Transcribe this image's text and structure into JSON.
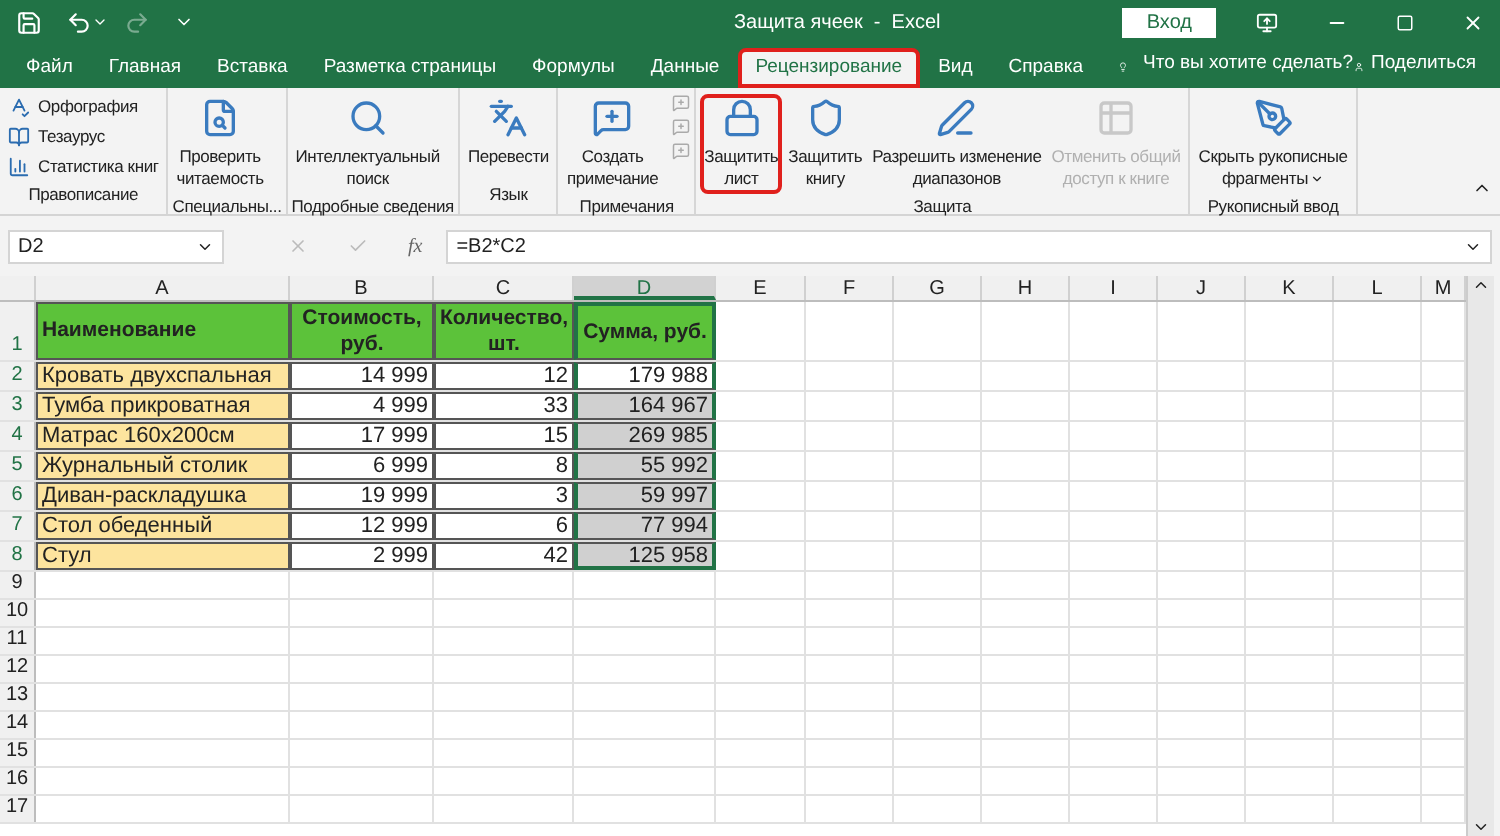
{
  "window": {
    "title": "Защита ячеек  -  Excel",
    "signin": "Вход"
  },
  "tabs": [
    {
      "label": "Файл",
      "selected": false,
      "highlighted": false
    },
    {
      "label": "Главная",
      "selected": false,
      "highlighted": false
    },
    {
      "label": "Вставка",
      "selected": false,
      "highlighted": false
    },
    {
      "label": "Разметка страницы",
      "selected": false,
      "highlighted": false
    },
    {
      "label": "Формулы",
      "selected": false,
      "highlighted": false
    },
    {
      "label": "Данные",
      "selected": false,
      "highlighted": false
    },
    {
      "label": "Рецензирование",
      "selected": true,
      "highlighted": true
    },
    {
      "label": "Вид",
      "selected": false,
      "highlighted": false
    },
    {
      "label": "Справка",
      "selected": false,
      "highlighted": false
    }
  ],
  "tell_me": "Что вы хотите сделать?",
  "share": "Поделиться",
  "ribbon": [
    {
      "label": "Правописание",
      "items": [
        {
          "kind": "small",
          "lines": [
            "Орфография"
          ],
          "disabled": false,
          "highlighted": false
        },
        {
          "kind": "small",
          "lines": [
            "Тезаурус"
          ],
          "disabled": false,
          "highlighted": false
        },
        {
          "kind": "small",
          "lines": [
            "Статистика книг"
          ],
          "disabled": false,
          "highlighted": false
        }
      ]
    },
    {
      "label": "Специальны...",
      "items": [
        {
          "kind": "large",
          "lines": [
            "Проверить",
            "читаемость"
          ],
          "disabled": false,
          "highlighted": false
        }
      ]
    },
    {
      "label": "Подробные сведения",
      "items": [
        {
          "kind": "large",
          "lines": [
            "Интеллектуальный",
            "поиск"
          ],
          "disabled": false,
          "highlighted": false
        }
      ]
    },
    {
      "label": "Язык",
      "items": [
        {
          "kind": "large",
          "lines": [
            "Перевести"
          ],
          "disabled": false,
          "highlighted": false
        }
      ]
    },
    {
      "label": "Примечания",
      "items": [
        {
          "kind": "large",
          "lines": [
            "Создать",
            "примечание"
          ],
          "disabled": false,
          "highlighted": false
        }
      ]
    },
    {
      "label": "Защита",
      "items": [
        {
          "kind": "large",
          "lines": [
            "Защитить",
            "лист"
          ],
          "disabled": false,
          "highlighted": true
        },
        {
          "kind": "large",
          "lines": [
            "Защитить",
            "книгу"
          ],
          "disabled": false,
          "highlighted": false
        },
        {
          "kind": "large",
          "lines": [
            "Разрешить изменение",
            "диапазонов"
          ],
          "disabled": false,
          "highlighted": false
        },
        {
          "kind": "large",
          "lines": [
            "Отменить общий",
            "доступ к книге"
          ],
          "disabled": true,
          "highlighted": false
        }
      ]
    },
    {
      "label": "Рукописный ввод",
      "items": [
        {
          "kind": "large",
          "lines": [
            "Скрыть рукописные",
            "фрагменты"
          ],
          "disabled": false,
          "highlighted": false
        }
      ]
    }
  ],
  "name_box": "D2",
  "function_label": "fx",
  "formula": "=B2*C2",
  "columns": [
    "A",
    "B",
    "C",
    "D",
    "E",
    "F",
    "G",
    "H",
    "I",
    "J",
    "K",
    "L",
    "M"
  ],
  "rows": [
    {
      "number": "1",
      "cells": [
        {
          "text": "Наименование",
          "kind": "header",
          "selected": false,
          "shaded": false
        },
        {
          "text": "Стоимость, руб.",
          "kind": "header",
          "selected": false,
          "shaded": false
        },
        {
          "text": "Количество, шт.",
          "kind": "header",
          "selected": false,
          "shaded": false
        },
        {
          "text": "Сумма, руб.",
          "kind": "header",
          "selected": true,
          "shaded": false
        }
      ]
    },
    {
      "number": "2",
      "cells": [
        {
          "text": "Кровать двухспальная",
          "kind": "name",
          "selected": false,
          "shaded": false
        },
        {
          "text": "14 999",
          "kind": "number",
          "selected": false,
          "shaded": false
        },
        {
          "text": "12",
          "kind": "number",
          "selected": false,
          "shaded": false
        },
        {
          "text": "179 988",
          "kind": "number",
          "selected": true,
          "shaded": false
        }
      ]
    },
    {
      "number": "3",
      "cells": [
        {
          "text": "Тумба прикроватная",
          "kind": "name",
          "selected": false,
          "shaded": false
        },
        {
          "text": "4 999",
          "kind": "number",
          "selected": false,
          "shaded": false
        },
        {
          "text": "33",
          "kind": "number",
          "selected": false,
          "shaded": false
        },
        {
          "text": "164 967",
          "kind": "number",
          "selected": true,
          "shaded": true
        }
      ]
    },
    {
      "number": "4",
      "cells": [
        {
          "text": "Матрас 160x200см",
          "kind": "name",
          "selected": false,
          "shaded": false
        },
        {
          "text": "17 999",
          "kind": "number",
          "selected": false,
          "shaded": false
        },
        {
          "text": "15",
          "kind": "number",
          "selected": false,
          "shaded": false
        },
        {
          "text": "269 985",
          "kind": "number",
          "selected": true,
          "shaded": true
        }
      ]
    },
    {
      "number": "5",
      "cells": [
        {
          "text": "Журнальный столик",
          "kind": "name",
          "selected": false,
          "shaded": false
        },
        {
          "text": "6 999",
          "kind": "number",
          "selected": false,
          "shaded": false
        },
        {
          "text": "8",
          "kind": "number",
          "selected": false,
          "shaded": false
        },
        {
          "text": "55 992",
          "kind": "number",
          "selected": true,
          "shaded": true
        }
      ]
    },
    {
      "number": "6",
      "cells": [
        {
          "text": "Диван-раскладушка",
          "kind": "name",
          "selected": false,
          "shaded": false
        },
        {
          "text": "19 999",
          "kind": "number",
          "selected": false,
          "shaded": false
        },
        {
          "text": "3",
          "kind": "number",
          "selected": false,
          "shaded": false
        },
        {
          "text": "59 997",
          "kind": "number",
          "selected": true,
          "shaded": true
        }
      ]
    },
    {
      "number": "7",
      "cells": [
        {
          "text": "Стол обеденный",
          "kind": "name",
          "selected": false,
          "shaded": false
        },
        {
          "text": "12 999",
          "kind": "number",
          "selected": false,
          "shaded": false
        },
        {
          "text": "6",
          "kind": "number",
          "selected": false,
          "shaded": false
        },
        {
          "text": "77 994",
          "kind": "number",
          "selected": true,
          "shaded": true
        }
      ]
    },
    {
      "number": "8",
      "cells": [
        {
          "text": "Стул",
          "kind": "name",
          "selected": false,
          "shaded": false
        },
        {
          "text": "2 999",
          "kind": "number",
          "selected": false,
          "shaded": false
        },
        {
          "text": "42",
          "kind": "number",
          "selected": false,
          "shaded": false
        },
        {
          "text": "125 958",
          "kind": "number",
          "selected": true,
          "shaded": true
        }
      ]
    },
    {
      "number": "9",
      "cells": []
    },
    {
      "number": "10",
      "cells": []
    },
    {
      "number": "11",
      "cells": []
    },
    {
      "number": "12",
      "cells": []
    },
    {
      "number": "13",
      "cells": []
    },
    {
      "number": "14",
      "cells": []
    },
    {
      "number": "15",
      "cells": []
    },
    {
      "number": "16",
      "cells": []
    },
    {
      "number": "17",
      "cells": []
    }
  ]
}
